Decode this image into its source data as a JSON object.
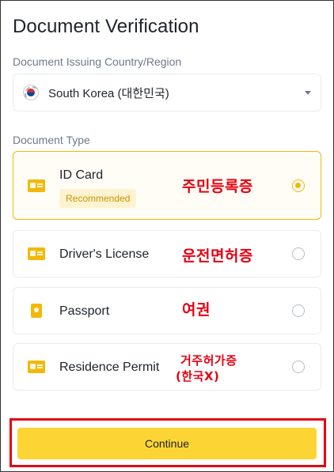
{
  "page": {
    "title": "Document Verification"
  },
  "country": {
    "label": "Document Issuing Country/Region",
    "selected": "South Korea (대한민국)",
    "flag_icon": "south-korea-flag-icon"
  },
  "document_type": {
    "label": "Document Type",
    "options": [
      {
        "name": "ID Card",
        "badge": "Recommended",
        "selected": true,
        "annotation": "주민등록증"
      },
      {
        "name": "Driver's License",
        "selected": false,
        "annotation": "운전면허증"
      },
      {
        "name": "Passport",
        "selected": false,
        "annotation": "여권"
      },
      {
        "name": "Residence Permit",
        "selected": false,
        "annotation_line1": "거주허가증",
        "annotation_line2": "(한국X)"
      }
    ]
  },
  "actions": {
    "continue_label": "Continue"
  },
  "colors": {
    "accent": "#f0b90b",
    "button": "#fcd535",
    "annotation_red": "#e60012"
  }
}
